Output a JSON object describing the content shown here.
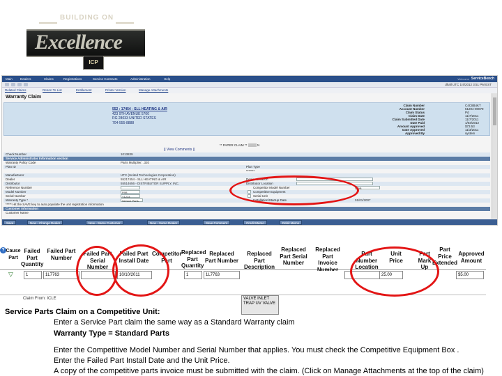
{
  "logo": {
    "top_text": "BUILDING ON",
    "script_text": "Excellence",
    "badge_text": "ICP"
  },
  "upper": {
    "nav_items": [
      "Main",
      "Dealers",
      "Claims",
      "Registrations",
      "Service Contracts",
      "Administration",
      "Help"
    ],
    "brand_prefix": "Welcome",
    "brand": "ServiceBench",
    "timestamp": "dhall UTC  1/4/2012 3:51 PM EST",
    "links": [
      "Related Claims",
      "Return To List",
      "Entitlement",
      "Printer Version",
      "Manage Attachments"
    ],
    "title": "Warranty Claim",
    "address_name": "552 : 17454 - SLL HEATING & AIR",
    "address_lines": [
      "423 9TH AVENUE 5700",
      "RG 28033 UNITED STATES",
      "704-555-8888"
    ],
    "right_fields": [
      {
        "key": "Claim Number",
        "value": "C4C8B4KT"
      },
      {
        "key": "Account Number",
        "value": "51204-00079"
      },
      {
        "key": "Claim Status",
        "value": "Pd"
      },
      {
        "key": "Claim Date",
        "value": "11/7/2011"
      },
      {
        "key": "Claim Submitted Date",
        "value": "11/7/2011"
      },
      {
        "key": "Date Paid",
        "value": "1/03/2012"
      },
      {
        "key": "Amount Approved",
        "value": "$73.53"
      },
      {
        "key": "Date Approved",
        "value": "11/3/2011"
      },
      {
        "key": "Approved By",
        "value": "system"
      }
    ],
    "view_comments": "|| View Comments ||",
    "paper_claim": "** PAPER CLAIM **",
    "paper_value": "N",
    "form_rows": [
      {
        "left": "Check Number",
        "mid": "1013839",
        "right": "",
        "rv": ""
      },
      {
        "left": "Service Administrator Information section",
        "mid": "",
        "right": "",
        "rv": ""
      },
      {
        "left": "Warranty Policy Code",
        "mid": "Parts Multiplier: .320",
        "right": "",
        "rv": ""
      },
      {
        "left": "Plan ID",
        "mid": "",
        "right": "Plan Type",
        "rv": ""
      },
      {
        "left": "",
        "mid": "",
        "right": "*******",
        "rv": ""
      },
      {
        "left": "Manufacturer",
        "mid": "UTC  (United Technologies Corporation)",
        "right": "",
        "rv": ""
      },
      {
        "left": "Dealer",
        "mid": "55217454 - SLL HEATING & AIR",
        "right": "Dealer Location",
        "rv": ""
      },
      {
        "left": "Distributor",
        "mid": "55514656 - DISTRIBUTOR SUPPLY, INC.",
        "right": "Distributor Location",
        "rv": ""
      },
      {
        "left": "Reference Number",
        "mid": "",
        "right": "Competitor Model Number",
        "rv": "P9B"
      },
      {
        "left": "Model Number",
        "mid": "P9B",
        "right": "Competitive Equipment",
        "rv": ""
      },
      {
        "left": "Serial Number",
        "mid": "Y1234",
        "right": "Serial Unit",
        "rv": ""
      },
      {
        "left": "Warranty Type *",
        "mid": "Service Parts",
        "right": "Installation/Startup Date",
        "rv": "01/01/2007"
      },
      {
        "left": "***** Hit the SAVE key to auto populate the unit registration information",
        "mid": "",
        "right": "",
        "rv": ""
      },
      {
        "left": "Customer Information",
        "mid": "",
        "right": "",
        "rv": ""
      },
      {
        "left": "Customer Name",
        "mid": "",
        "right": "",
        "rv": ""
      }
    ],
    "bottom_buttons": [
      "Save",
      "New - Change Dealer",
      "New - Same Customer",
      "New - Same Dealer",
      "Save Comment",
      "Credit Memo",
      "Debit Memo"
    ]
  },
  "table": {
    "headers": [
      "Cause Part",
      "Failed Part Quantity",
      "Failed Part Number",
      "Failed Part Serial Number",
      "Failed Part Install Date",
      "Competitor Part",
      "Replaced Part Quantity",
      "Replaced Part Number",
      "Replaced Part Description",
      "Replaced Part Serial Number",
      "Replaced Part Invoice Number",
      "Part Number Location",
      "Unit Price",
      "Part Mark Up",
      "Part Price Extended",
      "Approved Amount"
    ],
    "row": {
      "failed_qty": "1",
      "failed_number": "1L7763",
      "failed_serial": "",
      "install_date": "10/10/2011",
      "replaced_qty": "1",
      "replaced_number": "1L7763",
      "replaced_description": "VALVE INLET TRAP UV VALVE",
      "part_location": "",
      "unit_price": "25.00",
      "approved_amount": "$5.00"
    },
    "claim_from_label": "Claim From:",
    "claim_from_value": "ICLE"
  },
  "description": {
    "heading": "Service Parts Claim on a Competitive Unit:",
    "line1": "Enter a  Service Part claim the same  way as a Standard Warranty claim",
    "line2": "Warranty Type = Standard Parts",
    "line3": "Enter the Competitive Model Number and Serial Number that applies.  You must check the Competitive Equipment Box .",
    "line4": "Enter the Failed Part Install Date and the Unit Price.",
    "line5": "A copy of the competitive parts invoice must be submitted with the claim. (Click on Manage Attachments at the top of the claim)"
  },
  "colors": {
    "highlight": "#e31515",
    "nav": "#2a4f8a",
    "info_block": "#cfe0ee"
  }
}
